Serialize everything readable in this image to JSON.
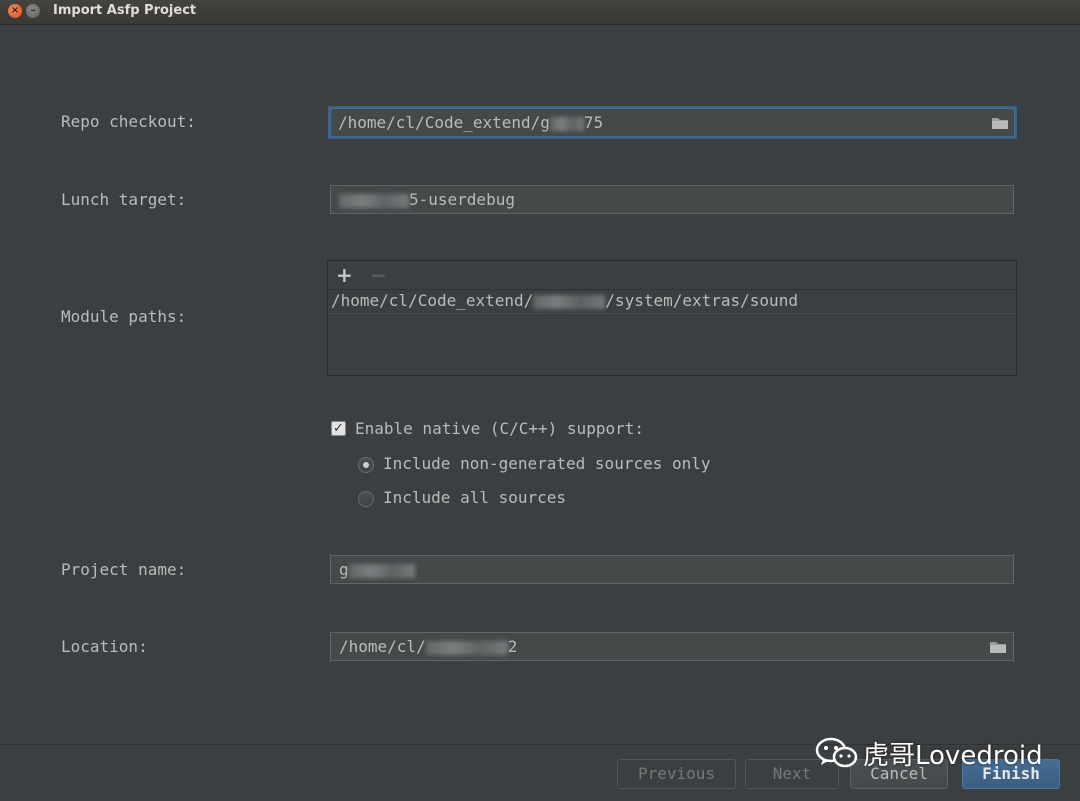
{
  "window": {
    "title": "Import Asfp Project",
    "close_glyph": "×",
    "min_glyph": "–"
  },
  "form": {
    "repo_checkout": {
      "label": "Repo checkout:",
      "value": "/home/cl/Code_extend/g",
      "value_tail": "75"
    },
    "lunch_target": {
      "label": "Lunch target:",
      "value": "5-userdebug"
    },
    "module_paths": {
      "label": "Module paths:",
      "add": "+",
      "remove": "−",
      "items": [
        {
          "prefix": "/home/cl/Code_extend/",
          "suffix": "/system/extras/sound"
        }
      ]
    },
    "native": {
      "label": "Enable native (C/C++) support:",
      "checked_glyph": "✓",
      "options": [
        {
          "label": "Include non-generated sources only"
        },
        {
          "label": "Include all sources"
        }
      ]
    },
    "project_name": {
      "label": "Project name:",
      "value": "g"
    },
    "location": {
      "label": "Location:",
      "value": "/home/cl/",
      "value_tail": "2"
    }
  },
  "buttons": {
    "previous": "Previous",
    "next": "Next",
    "cancel": "Cancel",
    "finish": "Finish"
  },
  "watermark": {
    "text": "虎哥Lovedroid"
  },
  "icons": {
    "folder": "folder-icon",
    "wechat": "wechat-icon"
  }
}
